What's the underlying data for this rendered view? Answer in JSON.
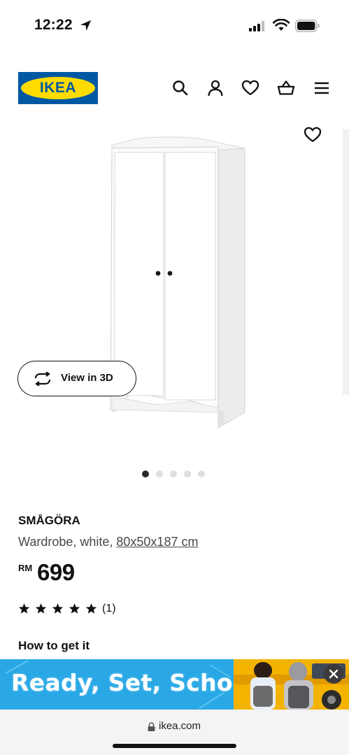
{
  "status_bar": {
    "time": "12:22",
    "location_icon": "location-arrow-icon",
    "signal_icon": "cellular-signal-icon",
    "wifi_icon": "wifi-icon",
    "battery_icon": "battery-icon"
  },
  "header": {
    "logo_text": "IKEA",
    "brand_colors": {
      "blue": "#0058a3",
      "yellow": "#ffdb00"
    },
    "icons": [
      "search-icon",
      "account-icon",
      "favourites-icon",
      "basket-icon",
      "menu-icon"
    ]
  },
  "product_image": {
    "favourite_icon": "heart-icon",
    "view_3d_label": "View in 3D",
    "carousel_total": 5,
    "carousel_active": 1
  },
  "product": {
    "name": "SMÅGÖRA",
    "description_prefix": "Wardrobe, white, ",
    "dimensions": "80x50x187 cm",
    "currency": "RM",
    "price": "699",
    "rating_stars": 5,
    "review_count": "(1)",
    "how_to_get_label": "How to get it"
  },
  "ad_banner": {
    "headline": "Ready, Set, School!",
    "close_icon": "close-icon",
    "background": "#2aa8e6"
  },
  "browser": {
    "url": "ikea.com",
    "lock_icon": "lock-icon"
  }
}
